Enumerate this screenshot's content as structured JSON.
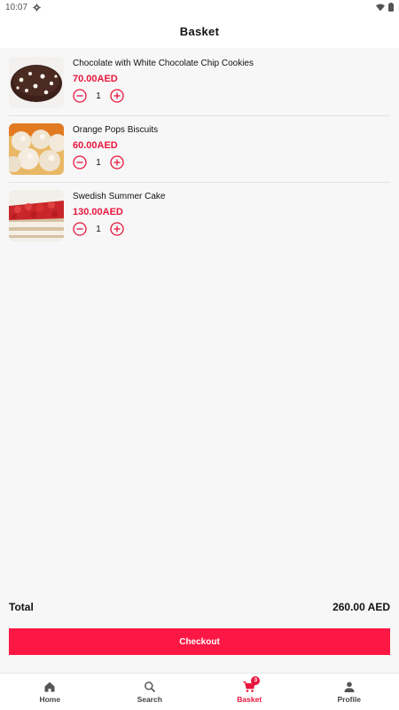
{
  "status_bar": {
    "time": "10:07"
  },
  "header": {
    "title": "Basket"
  },
  "items": [
    {
      "name": "Chocolate with White Chocolate Chip Cookies",
      "price": "70.00AED",
      "quantity": "1",
      "image": "chocolate-cookies"
    },
    {
      "name": "Orange Pops Biscuits",
      "price": "60.00AED",
      "quantity": "1",
      "image": "orange-biscuits"
    },
    {
      "name": "Swedish Summer Cake",
      "price": "130.00AED",
      "quantity": "1",
      "image": "summer-cake"
    }
  ],
  "total": {
    "label": "Total",
    "value": "260.00 AED"
  },
  "checkout": {
    "label": "Checkout"
  },
  "nav": {
    "home": "Home",
    "search": "Search",
    "basket": "Basket",
    "basket_badge": "3",
    "profile": "Profile",
    "active": "basket"
  },
  "colors": {
    "accent": "#e8173e",
    "checkout": "#fd1744"
  }
}
